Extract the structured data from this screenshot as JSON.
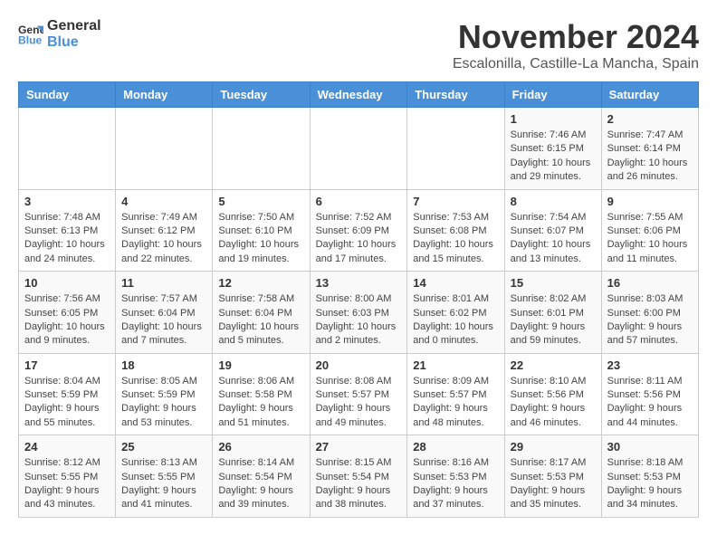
{
  "header": {
    "logo_general": "General",
    "logo_blue": "Blue",
    "month": "November 2024",
    "location": "Escalonilla, Castille-La Mancha, Spain"
  },
  "weekdays": [
    "Sunday",
    "Monday",
    "Tuesday",
    "Wednesday",
    "Thursday",
    "Friday",
    "Saturday"
  ],
  "weeks": [
    [
      {
        "day": "",
        "info": ""
      },
      {
        "day": "",
        "info": ""
      },
      {
        "day": "",
        "info": ""
      },
      {
        "day": "",
        "info": ""
      },
      {
        "day": "",
        "info": ""
      },
      {
        "day": "1",
        "info": "Sunrise: 7:46 AM\nSunset: 6:15 PM\nDaylight: 10 hours and 29 minutes."
      },
      {
        "day": "2",
        "info": "Sunrise: 7:47 AM\nSunset: 6:14 PM\nDaylight: 10 hours and 26 minutes."
      }
    ],
    [
      {
        "day": "3",
        "info": "Sunrise: 7:48 AM\nSunset: 6:13 PM\nDaylight: 10 hours and 24 minutes."
      },
      {
        "day": "4",
        "info": "Sunrise: 7:49 AM\nSunset: 6:12 PM\nDaylight: 10 hours and 22 minutes."
      },
      {
        "day": "5",
        "info": "Sunrise: 7:50 AM\nSunset: 6:10 PM\nDaylight: 10 hours and 19 minutes."
      },
      {
        "day": "6",
        "info": "Sunrise: 7:52 AM\nSunset: 6:09 PM\nDaylight: 10 hours and 17 minutes."
      },
      {
        "day": "7",
        "info": "Sunrise: 7:53 AM\nSunset: 6:08 PM\nDaylight: 10 hours and 15 minutes."
      },
      {
        "day": "8",
        "info": "Sunrise: 7:54 AM\nSunset: 6:07 PM\nDaylight: 10 hours and 13 minutes."
      },
      {
        "day": "9",
        "info": "Sunrise: 7:55 AM\nSunset: 6:06 PM\nDaylight: 10 hours and 11 minutes."
      }
    ],
    [
      {
        "day": "10",
        "info": "Sunrise: 7:56 AM\nSunset: 6:05 PM\nDaylight: 10 hours and 9 minutes."
      },
      {
        "day": "11",
        "info": "Sunrise: 7:57 AM\nSunset: 6:04 PM\nDaylight: 10 hours and 7 minutes."
      },
      {
        "day": "12",
        "info": "Sunrise: 7:58 AM\nSunset: 6:04 PM\nDaylight: 10 hours and 5 minutes."
      },
      {
        "day": "13",
        "info": "Sunrise: 8:00 AM\nSunset: 6:03 PM\nDaylight: 10 hours and 2 minutes."
      },
      {
        "day": "14",
        "info": "Sunrise: 8:01 AM\nSunset: 6:02 PM\nDaylight: 10 hours and 0 minutes."
      },
      {
        "day": "15",
        "info": "Sunrise: 8:02 AM\nSunset: 6:01 PM\nDaylight: 9 hours and 59 minutes."
      },
      {
        "day": "16",
        "info": "Sunrise: 8:03 AM\nSunset: 6:00 PM\nDaylight: 9 hours and 57 minutes."
      }
    ],
    [
      {
        "day": "17",
        "info": "Sunrise: 8:04 AM\nSunset: 5:59 PM\nDaylight: 9 hours and 55 minutes."
      },
      {
        "day": "18",
        "info": "Sunrise: 8:05 AM\nSunset: 5:59 PM\nDaylight: 9 hours and 53 minutes."
      },
      {
        "day": "19",
        "info": "Sunrise: 8:06 AM\nSunset: 5:58 PM\nDaylight: 9 hours and 51 minutes."
      },
      {
        "day": "20",
        "info": "Sunrise: 8:08 AM\nSunset: 5:57 PM\nDaylight: 9 hours and 49 minutes."
      },
      {
        "day": "21",
        "info": "Sunrise: 8:09 AM\nSunset: 5:57 PM\nDaylight: 9 hours and 48 minutes."
      },
      {
        "day": "22",
        "info": "Sunrise: 8:10 AM\nSunset: 5:56 PM\nDaylight: 9 hours and 46 minutes."
      },
      {
        "day": "23",
        "info": "Sunrise: 8:11 AM\nSunset: 5:56 PM\nDaylight: 9 hours and 44 minutes."
      }
    ],
    [
      {
        "day": "24",
        "info": "Sunrise: 8:12 AM\nSunset: 5:55 PM\nDaylight: 9 hours and 43 minutes."
      },
      {
        "day": "25",
        "info": "Sunrise: 8:13 AM\nSunset: 5:55 PM\nDaylight: 9 hours and 41 minutes."
      },
      {
        "day": "26",
        "info": "Sunrise: 8:14 AM\nSunset: 5:54 PM\nDaylight: 9 hours and 39 minutes."
      },
      {
        "day": "27",
        "info": "Sunrise: 8:15 AM\nSunset: 5:54 PM\nDaylight: 9 hours and 38 minutes."
      },
      {
        "day": "28",
        "info": "Sunrise: 8:16 AM\nSunset: 5:53 PM\nDaylight: 9 hours and 37 minutes."
      },
      {
        "day": "29",
        "info": "Sunrise: 8:17 AM\nSunset: 5:53 PM\nDaylight: 9 hours and 35 minutes."
      },
      {
        "day": "30",
        "info": "Sunrise: 8:18 AM\nSunset: 5:53 PM\nDaylight: 9 hours and 34 minutes."
      }
    ]
  ]
}
